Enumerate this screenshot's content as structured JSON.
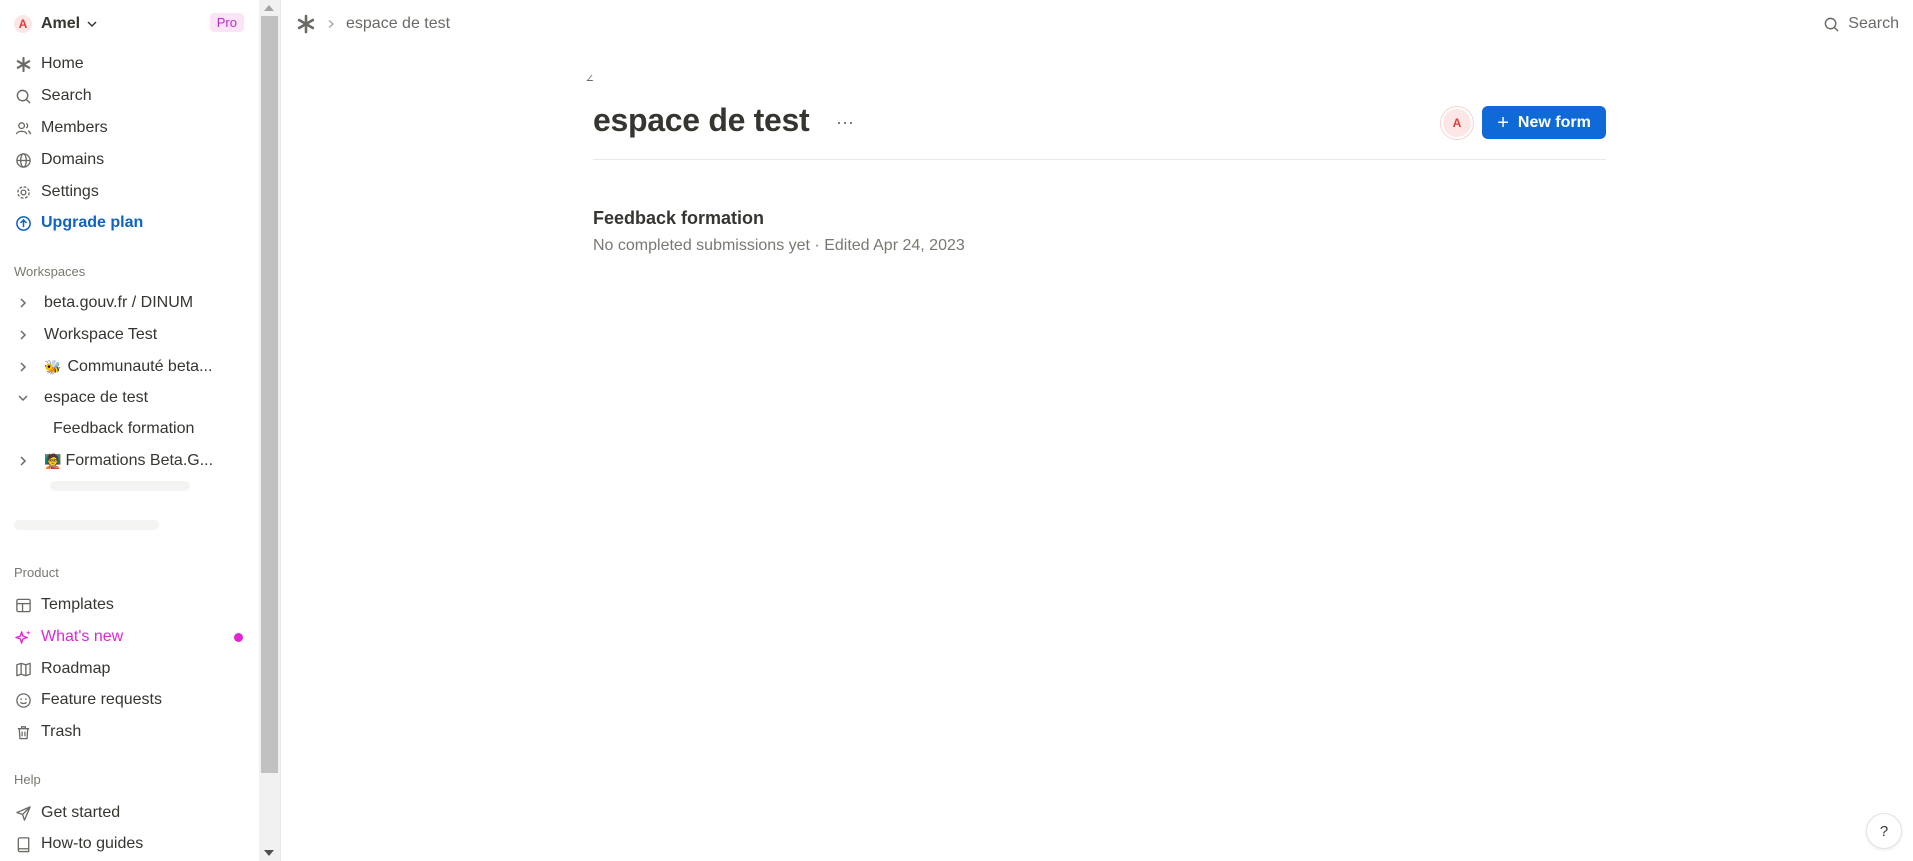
{
  "user": {
    "initial": "A",
    "name": "Amel",
    "plan_badge": "Pro"
  },
  "nav": {
    "home": "Home",
    "search": "Search",
    "members": "Members",
    "domains": "Domains",
    "settings": "Settings",
    "upgrade": "Upgrade plan"
  },
  "workspaces": {
    "label": "Workspaces",
    "items": [
      {
        "label": "beta.gouv.fr / DINUM",
        "expanded": false
      },
      {
        "label": "Workspace Test",
        "expanded": false
      },
      {
        "label": "Communauté beta...",
        "emoji": "🐝",
        "expanded": false
      },
      {
        "label": "espace de test",
        "expanded": true
      },
      {
        "label": "Feedback formation",
        "child": true
      },
      {
        "label": "Formations Beta.G...",
        "emoji": "🧑‍🏫",
        "expanded": false
      }
    ]
  },
  "product": {
    "label": "Product",
    "templates": "Templates",
    "whats_new": "What's new",
    "roadmap": "Roadmap",
    "feature_requests": "Feature requests",
    "trash": "Trash"
  },
  "help": {
    "label": "Help",
    "get_started": "Get started",
    "howto": "How-to guides",
    "button": "?"
  },
  "breadcrumb": {
    "current": "espace de test"
  },
  "top_search": "Search",
  "main": {
    "title": "espace de test",
    "more": "···",
    "member_initial": "A",
    "new_form": "New form",
    "forms": [
      {
        "title": "Feedback formation",
        "meta": "No completed submissions yet · Edited Apr 24, 2023"
      }
    ]
  },
  "colors": {
    "accent": "#0f6ad8",
    "upgrade": "#0f62c8",
    "whats_new": "#e125d6",
    "avatar_bg": "#fde6e6",
    "avatar_fg": "#e03e3e"
  }
}
